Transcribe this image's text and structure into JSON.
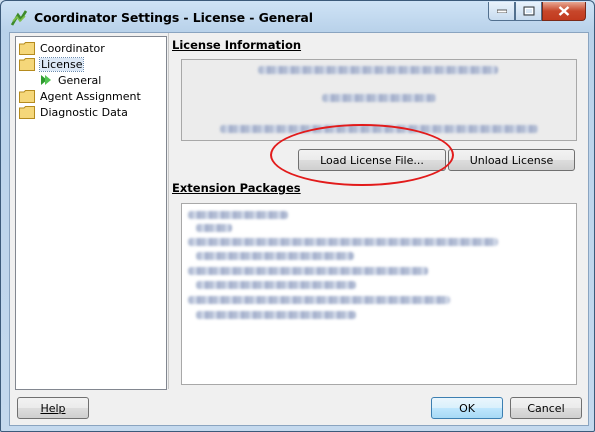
{
  "window": {
    "title": "Coordinator Settings - License - General"
  },
  "tree": {
    "items": [
      {
        "label": "Coordinator",
        "icon": "folder-icon"
      },
      {
        "label": "License",
        "icon": "folder-icon",
        "selected": true
      },
      {
        "label": "General",
        "icon": "arrow-icon"
      },
      {
        "label": "Agent Assignment",
        "icon": "folder-icon"
      },
      {
        "label": "Diagnostic Data",
        "icon": "folder-icon"
      }
    ]
  },
  "license": {
    "section_title": "License Information",
    "load_button": "Load License File...",
    "unload_button": "Unload License"
  },
  "extensions": {
    "section_title": "Extension Packages"
  },
  "footer": {
    "help_button": "Help",
    "ok_button": "OK",
    "cancel_button": "Cancel"
  },
  "colors": {
    "highlight": "#e21b1b",
    "selection": "#dce8f6"
  }
}
